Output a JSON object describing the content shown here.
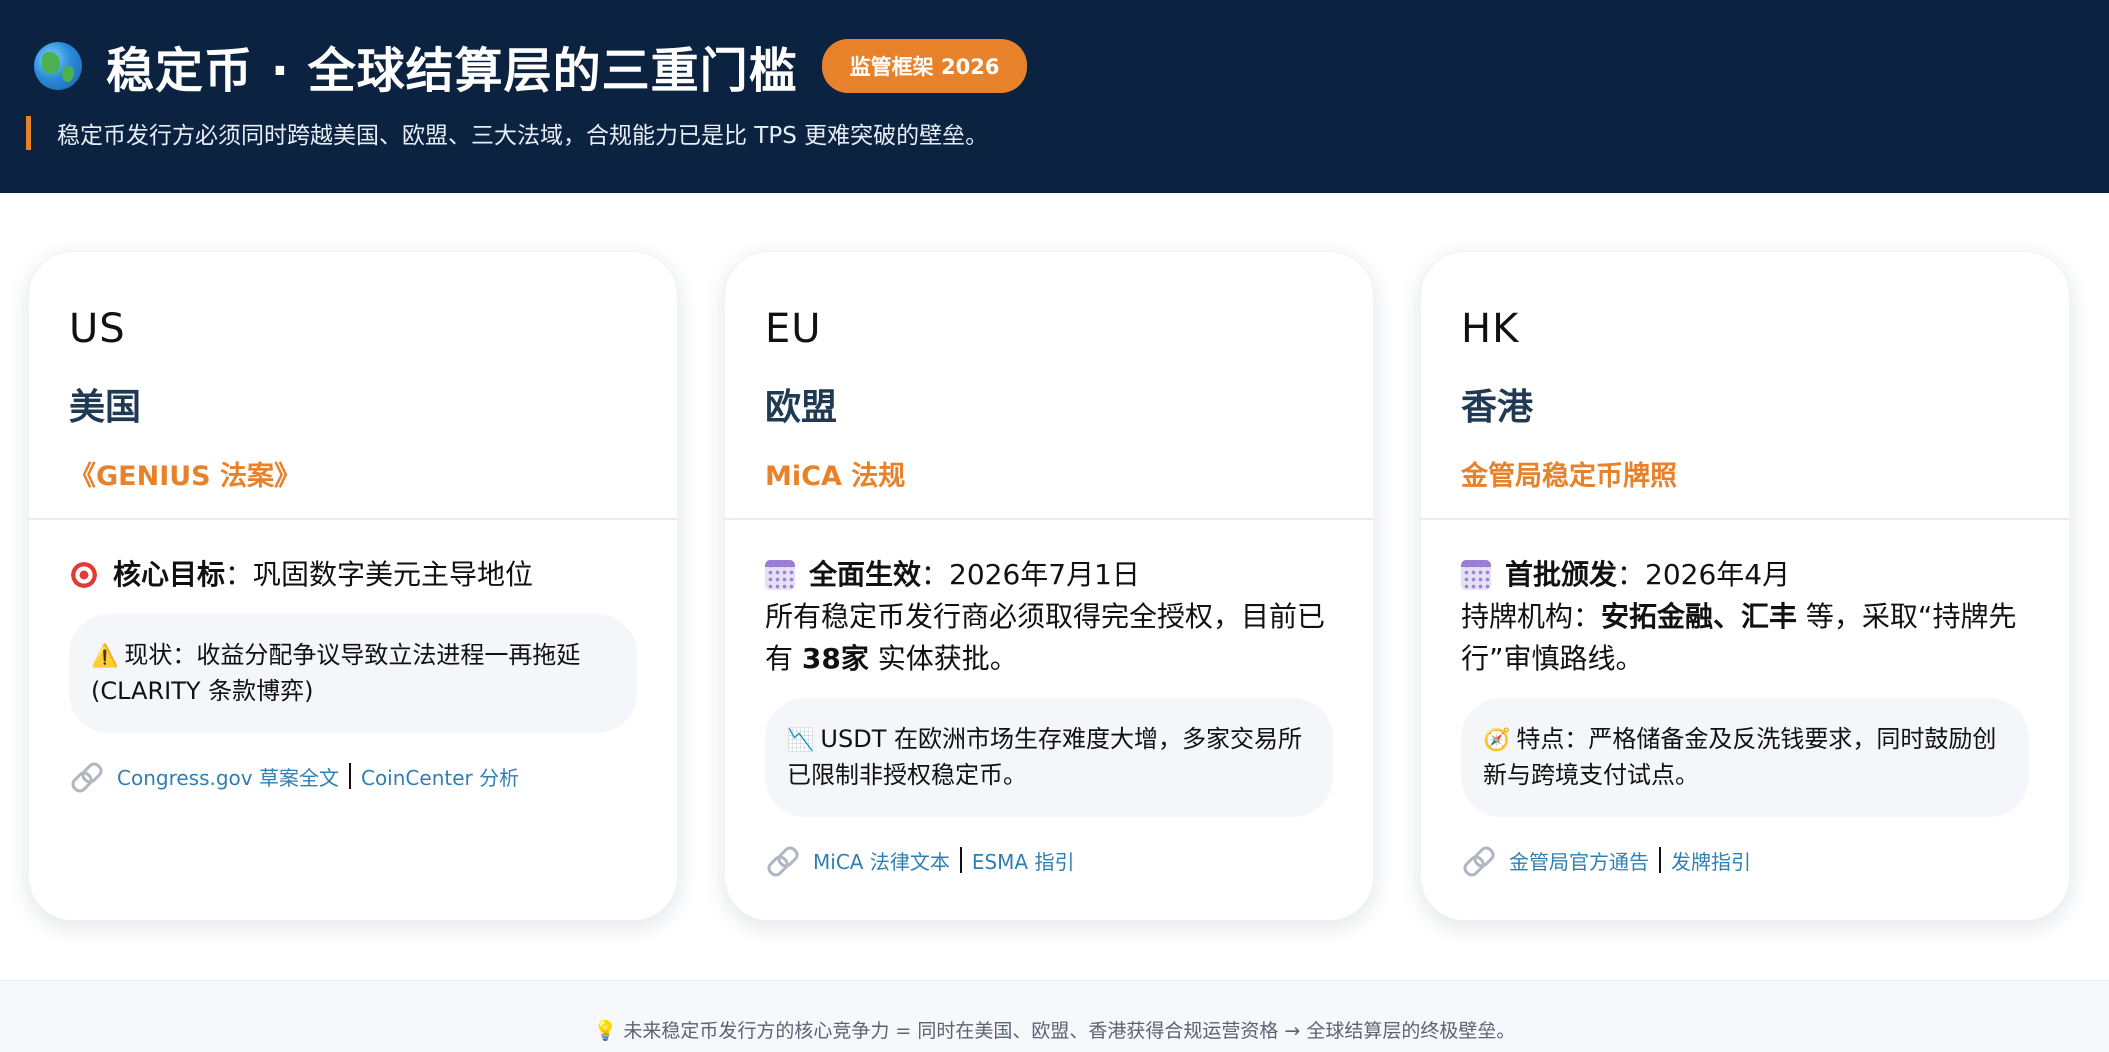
{
  "header": {
    "title": "稳定币 · 全球结算层的三重门槛",
    "badge": "监管框架 2026",
    "subtitle": "稳定币发行方必须同时跨越美国、欧盟、三大法域，合规能力已是比 TPS 更难突破的壁垒。"
  },
  "cards": [
    {
      "code": "US",
      "region": "美国",
      "law": "《GENIUS 法案》",
      "key": "核心目标",
      "key_value": "：巩固数字美元主导地位",
      "note_icon": "⚠️",
      "note": "现状：收益分配争议导致立法进程一再拖延 (CLARITY 条款博弈)",
      "links": [
        "Congress.gov 草案全文",
        "CoinCenter 分析"
      ]
    },
    {
      "code": "EU",
      "region": "欧盟",
      "law": "MiCA 法规",
      "key": "全面生效",
      "key_value": "：2026年7月1日",
      "desc_pre": "所有稳定币发行商必须取得完全授权，目前已有 ",
      "desc_bold": "38家",
      "desc_post": " 实体获批。",
      "note_icon": "📉",
      "note": "USDT 在欧洲市场生存难度大增，多家交易所已限制非授权稳定币。",
      "links": [
        "MiCA 法律文本",
        "ESMA 指引"
      ]
    },
    {
      "code": "HK",
      "region": "香港",
      "law": "金管局稳定币牌照",
      "key": "首批颁发",
      "key_value": "：2026年4月",
      "desc_pre": "持牌机构：",
      "desc_bold": "安拓金融、汇丰",
      "desc_post": " 等，采取“持牌先行”审慎路线。",
      "note_icon": "🧭",
      "note": "特点：严格储备金及反洗钱要求，同时鼓励创新与跨境支付试点。",
      "links": [
        "金管局官方通告",
        "发牌指引"
      ]
    }
  ],
  "footer": {
    "icon": "💡",
    "text": "未来稳定币发行方的核心竞争力 = 同时在美国、欧盟、香港获得合规运营资格 → 全球结算层的终极壁垒。"
  }
}
